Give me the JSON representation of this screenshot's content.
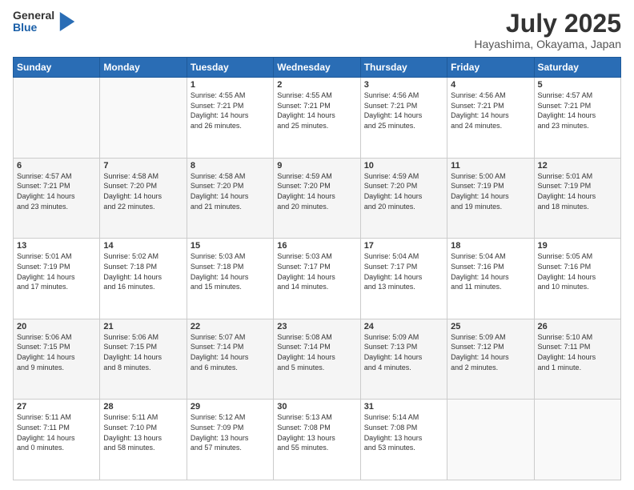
{
  "header": {
    "logo_general": "General",
    "logo_blue": "Blue",
    "month_title": "July 2025",
    "location": "Hayashima, Okayama, Japan"
  },
  "weekdays": [
    "Sunday",
    "Monday",
    "Tuesday",
    "Wednesday",
    "Thursday",
    "Friday",
    "Saturday"
  ],
  "weeks": [
    [
      {
        "day": "",
        "info": ""
      },
      {
        "day": "",
        "info": ""
      },
      {
        "day": "1",
        "info": "Sunrise: 4:55 AM\nSunset: 7:21 PM\nDaylight: 14 hours\nand 26 minutes."
      },
      {
        "day": "2",
        "info": "Sunrise: 4:55 AM\nSunset: 7:21 PM\nDaylight: 14 hours\nand 25 minutes."
      },
      {
        "day": "3",
        "info": "Sunrise: 4:56 AM\nSunset: 7:21 PM\nDaylight: 14 hours\nand 25 minutes."
      },
      {
        "day": "4",
        "info": "Sunrise: 4:56 AM\nSunset: 7:21 PM\nDaylight: 14 hours\nand 24 minutes."
      },
      {
        "day": "5",
        "info": "Sunrise: 4:57 AM\nSunset: 7:21 PM\nDaylight: 14 hours\nand 23 minutes."
      }
    ],
    [
      {
        "day": "6",
        "info": "Sunrise: 4:57 AM\nSunset: 7:21 PM\nDaylight: 14 hours\nand 23 minutes."
      },
      {
        "day": "7",
        "info": "Sunrise: 4:58 AM\nSunset: 7:20 PM\nDaylight: 14 hours\nand 22 minutes."
      },
      {
        "day": "8",
        "info": "Sunrise: 4:58 AM\nSunset: 7:20 PM\nDaylight: 14 hours\nand 21 minutes."
      },
      {
        "day": "9",
        "info": "Sunrise: 4:59 AM\nSunset: 7:20 PM\nDaylight: 14 hours\nand 20 minutes."
      },
      {
        "day": "10",
        "info": "Sunrise: 4:59 AM\nSunset: 7:20 PM\nDaylight: 14 hours\nand 20 minutes."
      },
      {
        "day": "11",
        "info": "Sunrise: 5:00 AM\nSunset: 7:19 PM\nDaylight: 14 hours\nand 19 minutes."
      },
      {
        "day": "12",
        "info": "Sunrise: 5:01 AM\nSunset: 7:19 PM\nDaylight: 14 hours\nand 18 minutes."
      }
    ],
    [
      {
        "day": "13",
        "info": "Sunrise: 5:01 AM\nSunset: 7:19 PM\nDaylight: 14 hours\nand 17 minutes."
      },
      {
        "day": "14",
        "info": "Sunrise: 5:02 AM\nSunset: 7:18 PM\nDaylight: 14 hours\nand 16 minutes."
      },
      {
        "day": "15",
        "info": "Sunrise: 5:03 AM\nSunset: 7:18 PM\nDaylight: 14 hours\nand 15 minutes."
      },
      {
        "day": "16",
        "info": "Sunrise: 5:03 AM\nSunset: 7:17 PM\nDaylight: 14 hours\nand 14 minutes."
      },
      {
        "day": "17",
        "info": "Sunrise: 5:04 AM\nSunset: 7:17 PM\nDaylight: 14 hours\nand 13 minutes."
      },
      {
        "day": "18",
        "info": "Sunrise: 5:04 AM\nSunset: 7:16 PM\nDaylight: 14 hours\nand 11 minutes."
      },
      {
        "day": "19",
        "info": "Sunrise: 5:05 AM\nSunset: 7:16 PM\nDaylight: 14 hours\nand 10 minutes."
      }
    ],
    [
      {
        "day": "20",
        "info": "Sunrise: 5:06 AM\nSunset: 7:15 PM\nDaylight: 14 hours\nand 9 minutes."
      },
      {
        "day": "21",
        "info": "Sunrise: 5:06 AM\nSunset: 7:15 PM\nDaylight: 14 hours\nand 8 minutes."
      },
      {
        "day": "22",
        "info": "Sunrise: 5:07 AM\nSunset: 7:14 PM\nDaylight: 14 hours\nand 6 minutes."
      },
      {
        "day": "23",
        "info": "Sunrise: 5:08 AM\nSunset: 7:14 PM\nDaylight: 14 hours\nand 5 minutes."
      },
      {
        "day": "24",
        "info": "Sunrise: 5:09 AM\nSunset: 7:13 PM\nDaylight: 14 hours\nand 4 minutes."
      },
      {
        "day": "25",
        "info": "Sunrise: 5:09 AM\nSunset: 7:12 PM\nDaylight: 14 hours\nand 2 minutes."
      },
      {
        "day": "26",
        "info": "Sunrise: 5:10 AM\nSunset: 7:11 PM\nDaylight: 14 hours\nand 1 minute."
      }
    ],
    [
      {
        "day": "27",
        "info": "Sunrise: 5:11 AM\nSunset: 7:11 PM\nDaylight: 14 hours\nand 0 minutes."
      },
      {
        "day": "28",
        "info": "Sunrise: 5:11 AM\nSunset: 7:10 PM\nDaylight: 13 hours\nand 58 minutes."
      },
      {
        "day": "29",
        "info": "Sunrise: 5:12 AM\nSunset: 7:09 PM\nDaylight: 13 hours\nand 57 minutes."
      },
      {
        "day": "30",
        "info": "Sunrise: 5:13 AM\nSunset: 7:08 PM\nDaylight: 13 hours\nand 55 minutes."
      },
      {
        "day": "31",
        "info": "Sunrise: 5:14 AM\nSunset: 7:08 PM\nDaylight: 13 hours\nand 53 minutes."
      },
      {
        "day": "",
        "info": ""
      },
      {
        "day": "",
        "info": ""
      }
    ]
  ]
}
